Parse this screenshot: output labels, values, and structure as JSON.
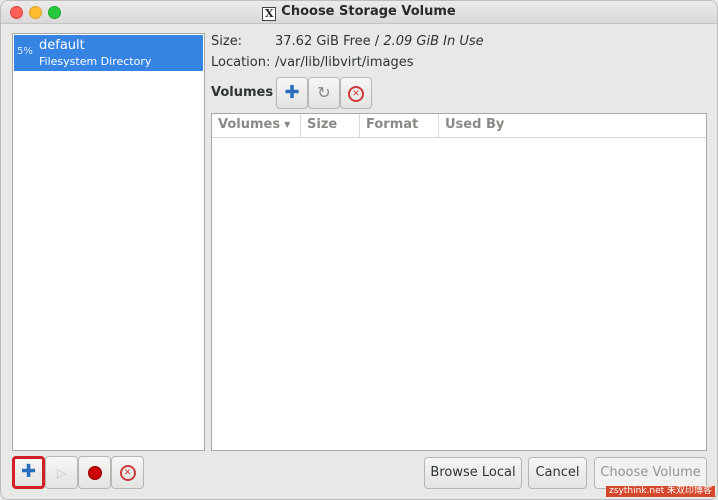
{
  "window": {
    "title": "Choose Storage Volume"
  },
  "pools": [
    {
      "usage": "5%",
      "name": "default",
      "type": "Filesystem Directory"
    }
  ],
  "info": {
    "size_label": "Size:",
    "size_free": "37.62 GiB Free",
    "size_sep": " / ",
    "size_used": "2.09 GiB In Use",
    "location_label": "Location:",
    "location_value": "/var/lib/libvirt/images"
  },
  "volumes": {
    "title": "Volumes",
    "columns": [
      "Volumes",
      "Size",
      "Format",
      "Used By"
    ],
    "rows": []
  },
  "buttons": {
    "browse_local": "Browse Local",
    "cancel": "Cancel",
    "choose_volume": "Choose Volume"
  },
  "icons": {
    "add_volume": "plus-icon",
    "refresh": "refresh-icon",
    "delete_volume": "delete-icon",
    "add_pool": "plus-icon",
    "start_pool": "play-icon",
    "stop_pool": "stop-icon",
    "delete_pool": "delete-icon"
  },
  "watermark": "zsythink.net 朱双印博客"
}
